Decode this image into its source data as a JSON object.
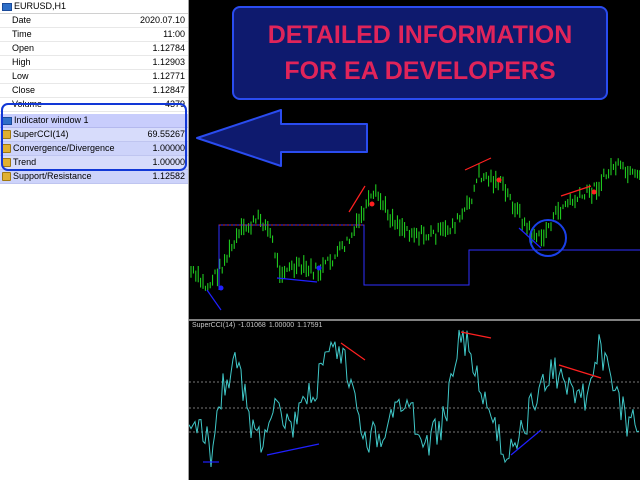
{
  "data_window": {
    "title": "EURUSD,H1",
    "rows": [
      {
        "label": "Date",
        "value": "2020.07.10"
      },
      {
        "label": "Time",
        "value": "11:00"
      },
      {
        "label": "Open",
        "value": "1.12784"
      },
      {
        "label": "High",
        "value": "1.12903"
      },
      {
        "label": "Low",
        "value": "1.12771"
      },
      {
        "label": "Close",
        "value": "1.12847"
      },
      {
        "label": "Volume",
        "value": "4379"
      }
    ],
    "indicator_window": "Indicator window 1",
    "indicators": [
      {
        "label": "SuperCCI(14)",
        "value": "69.55267"
      },
      {
        "label": "Convergence/Divergence",
        "value": "1.00000"
      },
      {
        "label": "Trend",
        "value": "1.00000"
      },
      {
        "label": "Support/Resistance",
        "value": "1.12582"
      }
    ]
  },
  "banner": {
    "line1": "DETAILED INFORMATION",
    "line2": "FOR EA DEVELOPERS"
  },
  "subwindow": {
    "name": "SuperCCI(14)",
    "values": [
      "-1.01068",
      "1.00000",
      "1.17591"
    ]
  },
  "colors": {
    "candle": "#22dd22",
    "divergence_bear": "#ff2020",
    "divergence_bull": "#2020ff",
    "support_resistance": "#3030ff",
    "cci_line": "#40c8c8",
    "highlight": "#1a40e8",
    "banner_text": "#e0245a",
    "banner_bg": "#0e1a6e"
  }
}
